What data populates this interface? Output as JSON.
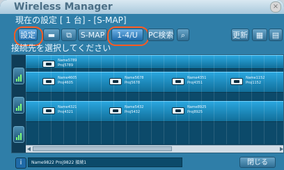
{
  "window": {
    "title": "Wireless Manager"
  },
  "status": {
    "text": "現在の設定 [ 1 台] - [S-MAP]"
  },
  "toolbar": {
    "settings_label": "設定",
    "smap_label": "S-MAP",
    "split_label": "1-4/U",
    "search_label": "PC検索",
    "update_label": "更新"
  },
  "prompt": {
    "text": "接続先を選択してください"
  },
  "devices": [
    {
      "line1": "Name5789",
      "line2": "Proj5789"
    },
    {
      "line1": "Name4605",
      "line2": "Proj4605"
    },
    {
      "line1": "Name5678",
      "line2": "Proj5678"
    },
    {
      "line1": "Name4351",
      "line2": "Proj4351"
    },
    {
      "line1": "Name1152",
      "line2": "Proj1152"
    },
    {
      "line1": "Name4321",
      "line2": "Proj4321"
    },
    {
      "line1": "Name5432",
      "line2": "Proj5432"
    },
    {
      "line1": "Name8925",
      "line2": "Proj8925"
    }
  ],
  "footer": {
    "info": "Name9822 Proj9822 接続1",
    "close_label": "閉じる"
  },
  "colors": {
    "accent": "#ff5a1f",
    "panel": "#0a3c58",
    "band": "#2aa6de"
  }
}
